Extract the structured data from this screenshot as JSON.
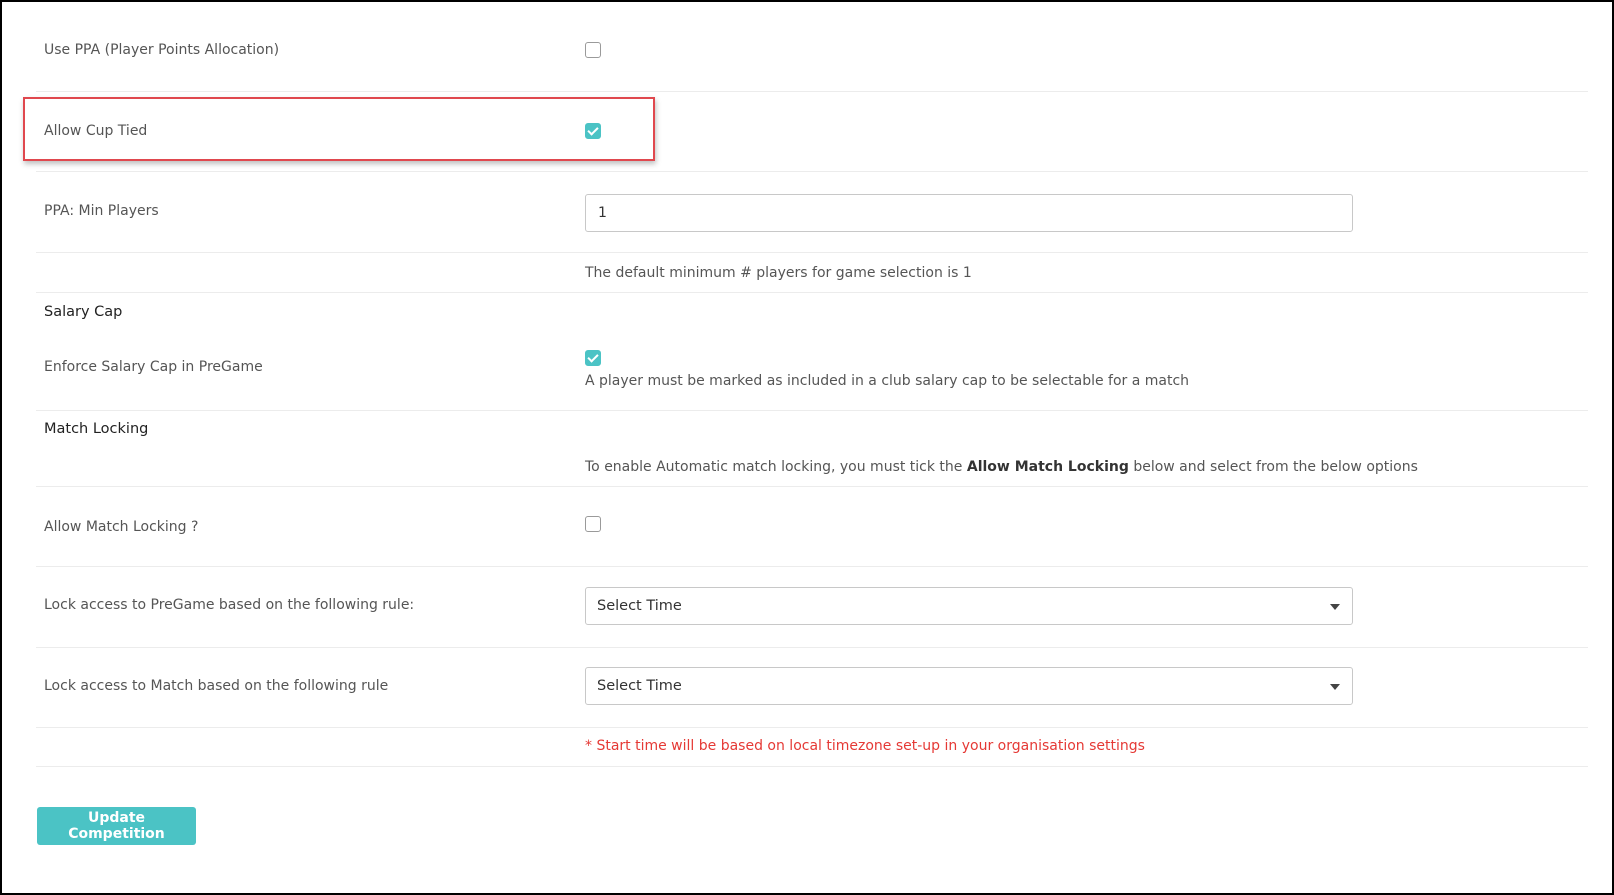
{
  "fields": {
    "use_ppa": {
      "label": "Use PPA (Player Points Allocation)",
      "checked": false
    },
    "allow_cup_tied": {
      "label": "Allow Cup Tied",
      "checked": true
    },
    "ppa_min_players": {
      "label": "PPA: Min Players",
      "value": "1",
      "help": "The default minimum # players for game selection is 1"
    }
  },
  "salary_cap": {
    "title": "Salary Cap",
    "enforce": {
      "label": "Enforce Salary Cap in PreGame",
      "checked": true,
      "help": "A player must be marked as included in a club salary cap to be selectable for a match"
    }
  },
  "match_locking": {
    "title": "Match Locking",
    "help_prefix": "To enable Automatic match locking, you must tick the ",
    "help_bold": "Allow Match Locking",
    "help_suffix": " below and select from the below options",
    "allow": {
      "label": "Allow Match Locking ?",
      "checked": false
    },
    "pregame_rule": {
      "label": "Lock access to PreGame based on the following rule:",
      "selected": "Select Time"
    },
    "match_rule": {
      "label": "Lock access to Match based on the following rule",
      "selected": "Select Time"
    },
    "warning": "* Start time will be based on local timezone set-up in your organisation settings"
  },
  "actions": {
    "update_label": "Update Competition"
  },
  "colors": {
    "accent": "#4bc3c5",
    "warning": "#e53935",
    "highlight_border": "#e0484e"
  },
  "icons": {
    "select_caret": "caret-down-icon",
    "check": "checkmark-icon"
  }
}
